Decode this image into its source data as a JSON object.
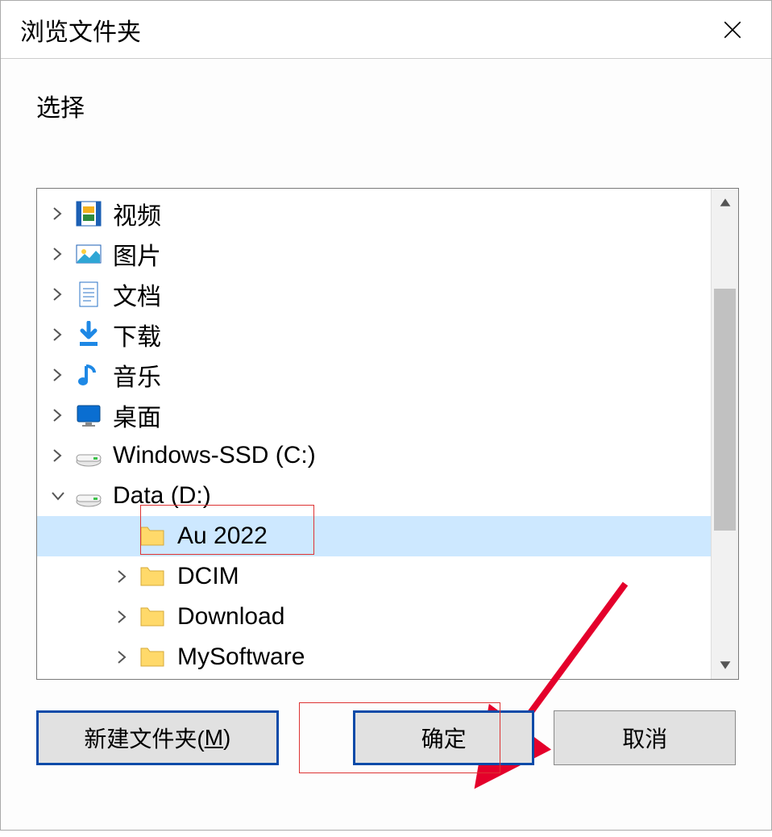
{
  "title": "浏览文件夹",
  "prompt": "选择",
  "tree": {
    "items": [
      {
        "id": "videos",
        "label": "视频",
        "icon": "video-icon",
        "indent": 1,
        "exp": "collapsed"
      },
      {
        "id": "pictures",
        "label": "图片",
        "icon": "pictures-icon",
        "indent": 1,
        "exp": "collapsed"
      },
      {
        "id": "docs",
        "label": "文档",
        "icon": "document-icon",
        "indent": 1,
        "exp": "collapsed"
      },
      {
        "id": "downloads",
        "label": "下载",
        "icon": "download-icon",
        "indent": 1,
        "exp": "collapsed"
      },
      {
        "id": "music",
        "label": "音乐",
        "icon": "music-icon",
        "indent": 1,
        "exp": "collapsed"
      },
      {
        "id": "desktop",
        "label": "桌面",
        "icon": "desktop-icon",
        "indent": 1,
        "exp": "collapsed"
      },
      {
        "id": "drive-c",
        "label": "Windows-SSD (C:)",
        "icon": "drive-icon",
        "indent": 1,
        "exp": "collapsed"
      },
      {
        "id": "drive-d",
        "label": "Data (D:)",
        "icon": "drive-icon",
        "indent": 1,
        "exp": "expanded"
      },
      {
        "id": "au2022",
        "label": "Au 2022",
        "icon": "folder-icon",
        "indent": 3,
        "exp": "none",
        "selected": true
      },
      {
        "id": "dcim",
        "label": "DCIM",
        "icon": "folder-icon",
        "indent": 3,
        "exp": "collapsed"
      },
      {
        "id": "download2",
        "label": "Download",
        "icon": "folder-icon",
        "indent": 3,
        "exp": "collapsed"
      },
      {
        "id": "mysoft",
        "label": "MySoftware",
        "icon": "folder-icon",
        "indent": 3,
        "exp": "collapsed"
      }
    ]
  },
  "buttons": {
    "new_folder": "新建文件夹(",
    "new_folder_key": "M",
    "new_folder_close": ")",
    "ok": "确定",
    "cancel": "取消"
  },
  "icons": {
    "chevron_right": ">",
    "chevron_down": "v",
    "close": "x"
  }
}
